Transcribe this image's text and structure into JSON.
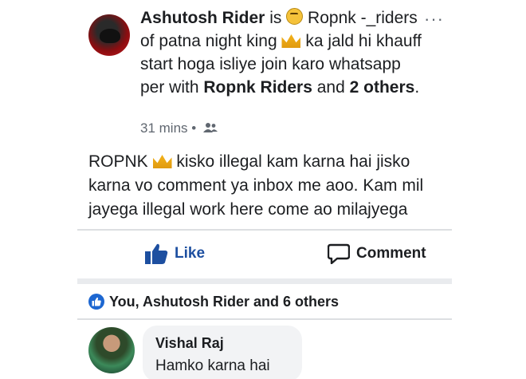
{
  "post": {
    "author": "Ashutosh Rider",
    "is_word": "is",
    "feeling_text_1": "Ropnk -_riders",
    "feeling_text_2": "of patna night king",
    "feeling_text_3": "ka jald hi khauff start hoga isliye join karo whatsapp per with",
    "with_person": "Ropnk Riders",
    "and_word": "and",
    "others": "2 others",
    "period": ".",
    "time": "31 mins",
    "dot": "•",
    "body_1": "ROPNK",
    "body_2": "kisko illegal kam karna hai jisko karna vo comment ya inbox me aoo. Kam mil jayega illegal work here come ao  milajyega"
  },
  "actions": {
    "like_label": "Like",
    "comment_label": "Comment"
  },
  "reactions": {
    "text": "You, Ashutosh Rider and 6 others"
  },
  "comment": {
    "name": "Vishal Raj",
    "text": "Hamko karna hai"
  },
  "colors": {
    "link_blue": "#1d4fa0",
    "meta_gray": "#606770",
    "divider": "#dddfe2"
  }
}
